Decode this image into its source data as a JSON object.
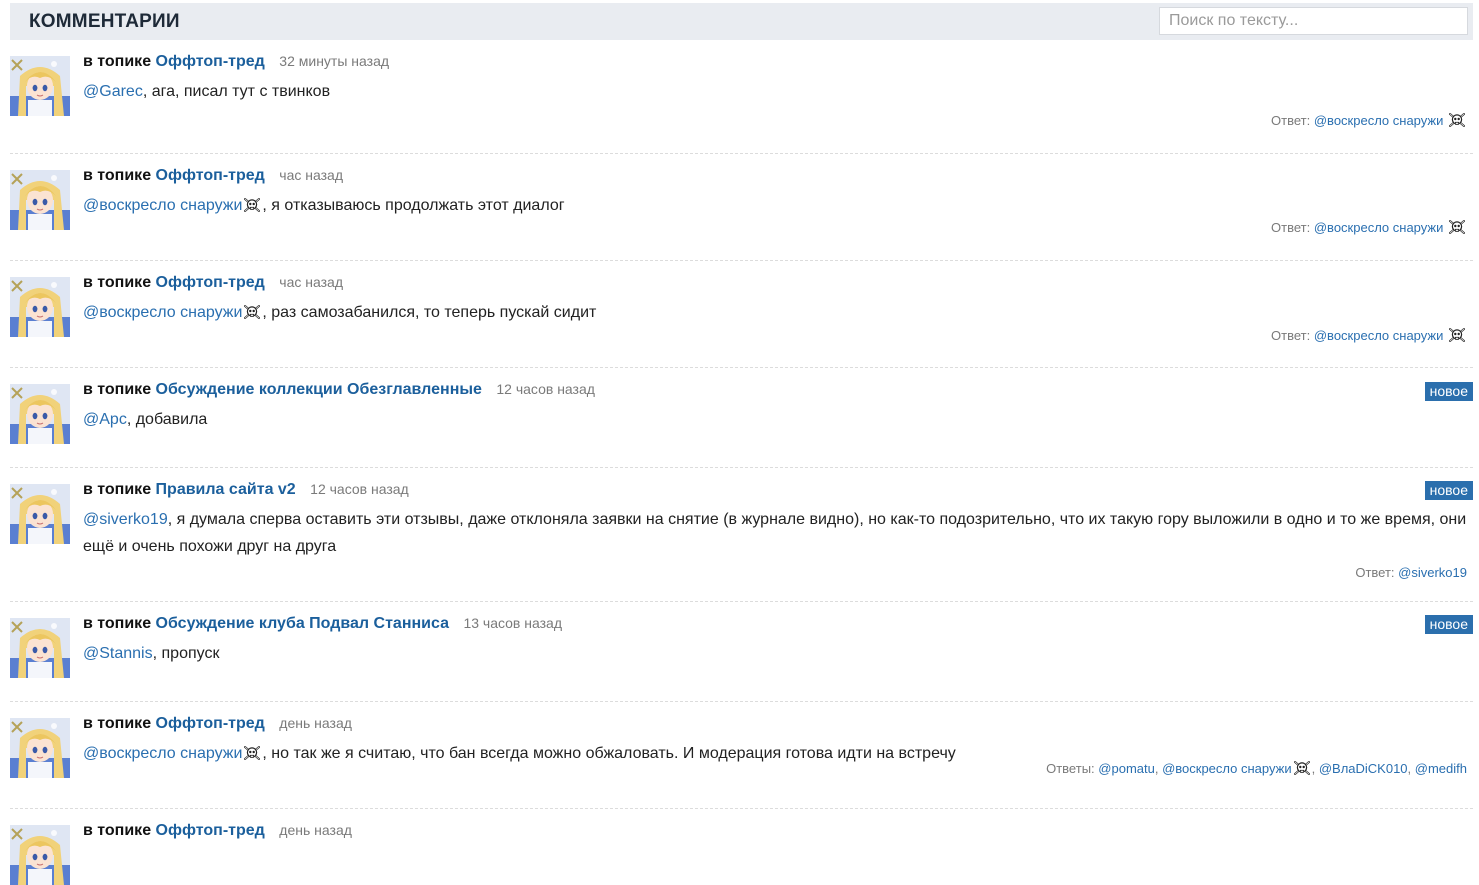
{
  "header": {
    "title": "КОММЕНТАРИИ",
    "search_placeholder": "Поиск по тексту..."
  },
  "labels": {
    "in_topic": "в топике",
    "new_badge": "новое",
    "reply_single": "Ответ:",
    "reply_plural": "Ответы:"
  },
  "comments": [
    {
      "topic": "Оффтоп-тред",
      "time": "32 минуты назад",
      "mention": "@Garec",
      "text": ", ага, писал тут с твинков",
      "replies": "@воскресло снаружи"
    },
    {
      "topic": "Оффтоп-тред",
      "time": "час назад",
      "mention": "@воскресло снаружи",
      "text": ", я отказываюсь продолжать этот диалог",
      "replies": "@воскресло снаружи"
    },
    {
      "topic": "Оффтоп-тред",
      "time": "час назад",
      "mention": "@воскресло снаружи",
      "text": ", раз самозабанился, то теперь пускай сидит",
      "replies": "@воскресло снаружи"
    },
    {
      "topic": "Обсуждение коллекции Обезглавленные",
      "time": "12 часов назад",
      "mention": "@Арс",
      "text": ", добавила",
      "new": true
    },
    {
      "topic": "Правила сайта v2",
      "time": "12 часов назад",
      "mention": "@siverko19",
      "text": ", я думала сперва оставить эти отзывы, даже отклоняла заявки на снятие (в журнале видно), но как-то подозрительно, что их такую гору выложили в одно и то же время, они ещё и очень похожи друг на друга",
      "new": true,
      "replies": "@siverko19"
    },
    {
      "topic": "Обсуждение клуба Подвал Станниса",
      "time": "13 часов назад",
      "mention": "@Stannis",
      "text": ", пропуск",
      "new": true
    },
    {
      "topic": "Оффтоп-тред",
      "time": "день назад",
      "mention": "@воскресло снаружи",
      "text": ", но так же я считаю, что бан всегда можно обжаловать. И модерация готова идти на встречу",
      "replies_multi": [
        "@pomatu",
        "@воскресло снаружи",
        "@ВлаDiCK010",
        "@medifh"
      ]
    },
    {
      "topic": "Оффтоп-тред",
      "time": "день назад"
    }
  ]
}
